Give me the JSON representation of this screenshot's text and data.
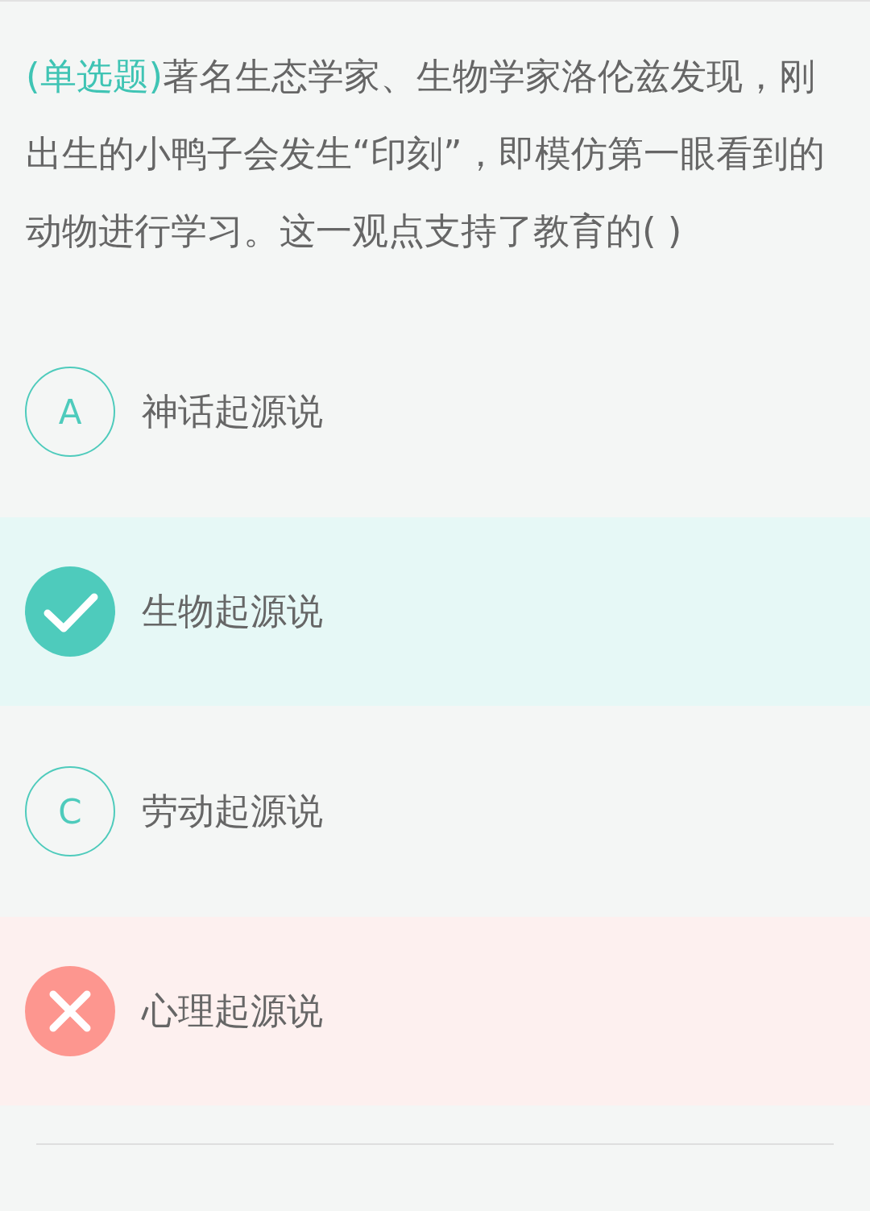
{
  "question": {
    "type_label": "(单选题)",
    "text": "著名生态学家、生物学家洛伦兹发现，刚出生的小鸭子会发生“印刻”，即模仿第一眼看到的动物进行学习。这一观点支持了教育的( )"
  },
  "options": [
    {
      "kind": "normal",
      "letter": "A",
      "text": "神话起源说"
    },
    {
      "kind": "correct",
      "text": "生物起源说"
    },
    {
      "kind": "normal",
      "letter": "C",
      "text": "劳动起源说"
    },
    {
      "kind": "wrong",
      "text": "心理起源说"
    }
  ]
}
